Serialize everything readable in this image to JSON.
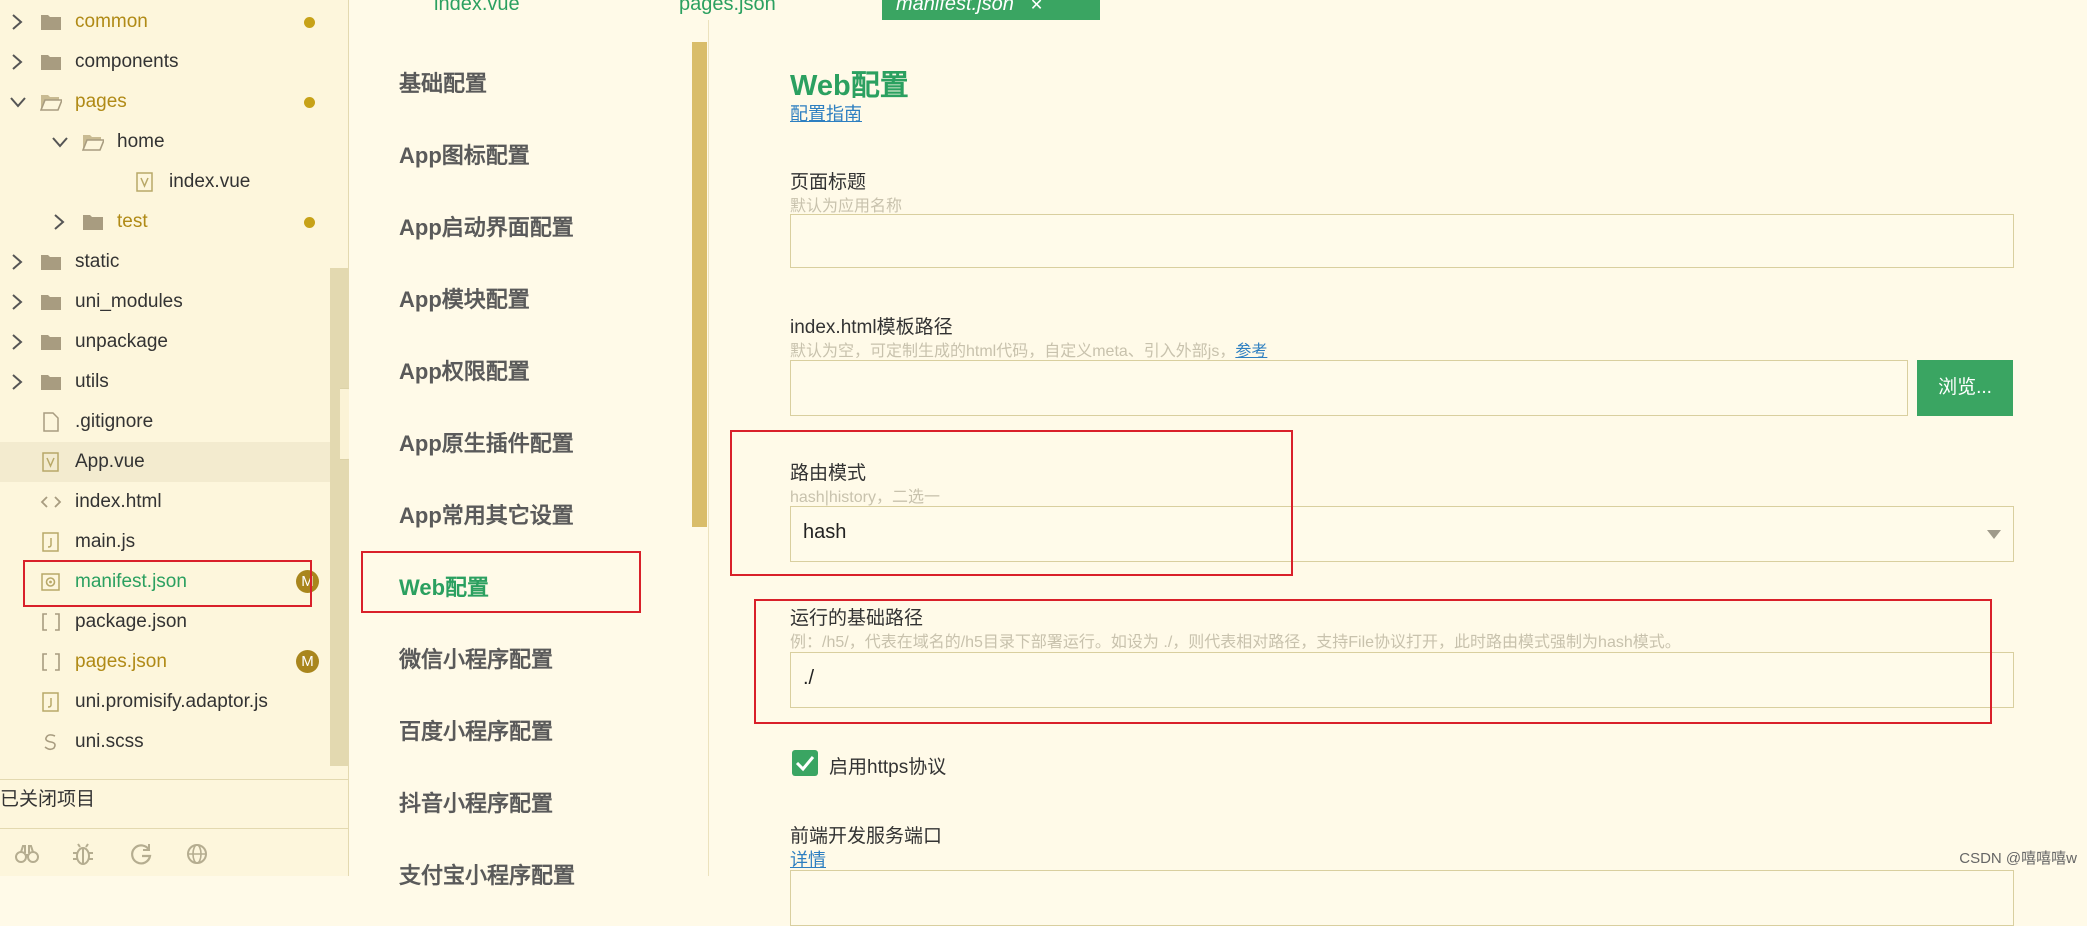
{
  "tree": {
    "items": [
      {
        "label": "common",
        "depth": 0,
        "type": "folder",
        "expanded": false,
        "mark": "dot",
        "color": "yellow"
      },
      {
        "label": "components",
        "depth": 0,
        "type": "folder",
        "expanded": false
      },
      {
        "label": "pages",
        "depth": 0,
        "type": "folder",
        "expanded": true,
        "mark": "dot",
        "color": "yellow"
      },
      {
        "label": "home",
        "depth": 1,
        "type": "folder",
        "expanded": true
      },
      {
        "label": "index.vue",
        "depth": 2,
        "type": "vue"
      },
      {
        "label": "test",
        "depth": 1,
        "type": "folder",
        "expanded": false,
        "mark": "dot",
        "color": "yellow"
      },
      {
        "label": "static",
        "depth": 0,
        "type": "folder",
        "expanded": false
      },
      {
        "label": "uni_modules",
        "depth": 0,
        "type": "folder",
        "expanded": false
      },
      {
        "label": "unpackage",
        "depth": 0,
        "type": "folder",
        "expanded": false
      },
      {
        "label": "utils",
        "depth": 0,
        "type": "folder",
        "expanded": false
      },
      {
        "label": ".gitignore",
        "depth": 0,
        "type": "file"
      },
      {
        "label": "App.vue",
        "depth": 0,
        "type": "vue",
        "selected": true
      },
      {
        "label": "index.html",
        "depth": 0,
        "type": "html"
      },
      {
        "label": "main.js",
        "depth": 0,
        "type": "js"
      },
      {
        "label": "manifest.json",
        "depth": 0,
        "type": "gear",
        "mark": "M",
        "color": "green"
      },
      {
        "label": "package.json",
        "depth": 0,
        "type": "json"
      },
      {
        "label": "pages.json",
        "depth": 0,
        "type": "json",
        "mark": "M",
        "color": "yellow"
      },
      {
        "label": "uni.promisify.adaptor.js",
        "depth": 0,
        "type": "js"
      },
      {
        "label": "uni.scss",
        "depth": 0,
        "type": "scss"
      }
    ],
    "closed_projects": "已关闭项目"
  },
  "tabs": [
    {
      "label": "index.vue"
    },
    {
      "label": "pages.json"
    },
    {
      "label": "manifest.json",
      "active": true,
      "close": "✕"
    }
  ],
  "nav": {
    "items": [
      {
        "label": "基础配置"
      },
      {
        "label": "App图标配置"
      },
      {
        "label": "App启动界面配置"
      },
      {
        "label": "App模块配置"
      },
      {
        "label": "App权限配置"
      },
      {
        "label": "App原生插件配置"
      },
      {
        "label": "App常用其它设置"
      },
      {
        "label": "Web配置",
        "active": true
      },
      {
        "label": "微信小程序配置"
      },
      {
        "label": "百度小程序配置"
      },
      {
        "label": "抖音小程序配置"
      },
      {
        "label": "支付宝小程序配置"
      }
    ]
  },
  "form": {
    "title": "Web配置",
    "guide_link": "配置指南",
    "page_title": {
      "label": "页面标题",
      "hint": "默认为应用名称",
      "value": ""
    },
    "template": {
      "label": "index.html模板路径",
      "hint": "默认为空，可定制生成的html代码，自定义meta、引入外部js，",
      "hint_link": "参考",
      "value": "",
      "browse": "浏览..."
    },
    "router": {
      "label": "路由模式",
      "hint": "hash|history，二选一",
      "value": "hash"
    },
    "base": {
      "label": "运行的基础路径",
      "hint": "例：/h5/，代表在域名的/h5目录下部署运行。如设为 ./，则代表相对路径，支持File协议打开，此时路由模式强制为hash模式。",
      "value": "./"
    },
    "https": {
      "label": "启用https协议",
      "checked": true
    },
    "port": {
      "label": "前端开发服务端口",
      "link": "详情"
    }
  },
  "watermark": "CSDN @嘻嘻嘻w",
  "colors": {
    "accent": "#3aa562",
    "highlight": "#d9202a",
    "modified": "#c7a218"
  }
}
